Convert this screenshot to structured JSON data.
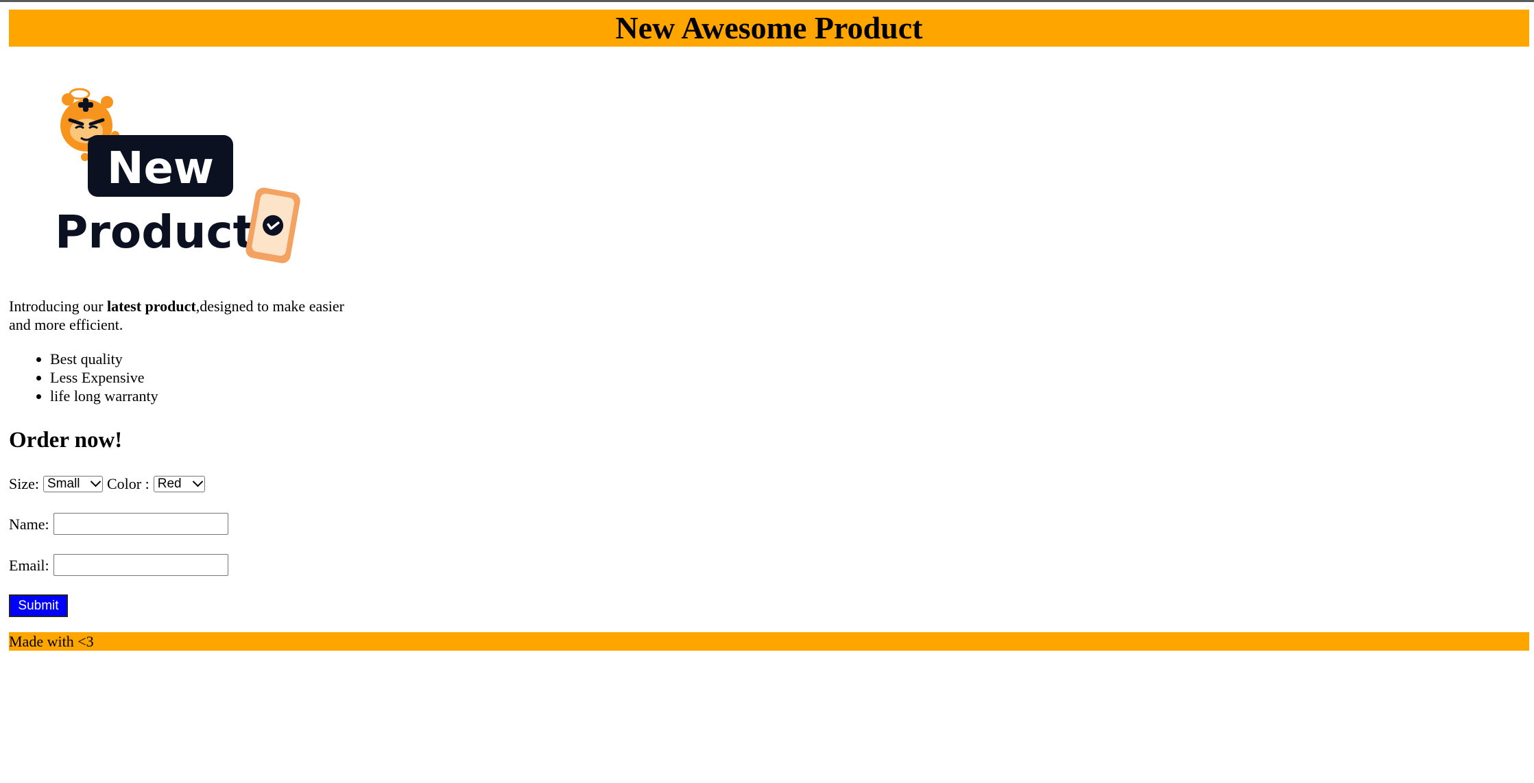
{
  "header": {
    "title": "New Awesome Product"
  },
  "hero": {
    "label_line1": "New",
    "label_line2": "Product!",
    "colors": {
      "orange": "#f7941d",
      "dark": "#0b1120",
      "phone": "#f4a261"
    }
  },
  "intro": {
    "prefix": "Introducing our ",
    "bold": "latest product",
    "suffix": ",designed to make easier and more efficient."
  },
  "features": [
    "Best quality",
    "Less Expensive",
    "life long warranty"
  ],
  "order": {
    "title": "Order now!",
    "size_label": "Size:",
    "size_value": "Small",
    "color_label": "Color :",
    "color_value": "Red",
    "name_label": "Name:",
    "name_value": "",
    "email_label": "Email:",
    "email_value": "",
    "submit_label": "Submit"
  },
  "footer": {
    "text": "Made with <3"
  },
  "theme": {
    "accent": "#ffa500",
    "button": "#0000ff"
  }
}
